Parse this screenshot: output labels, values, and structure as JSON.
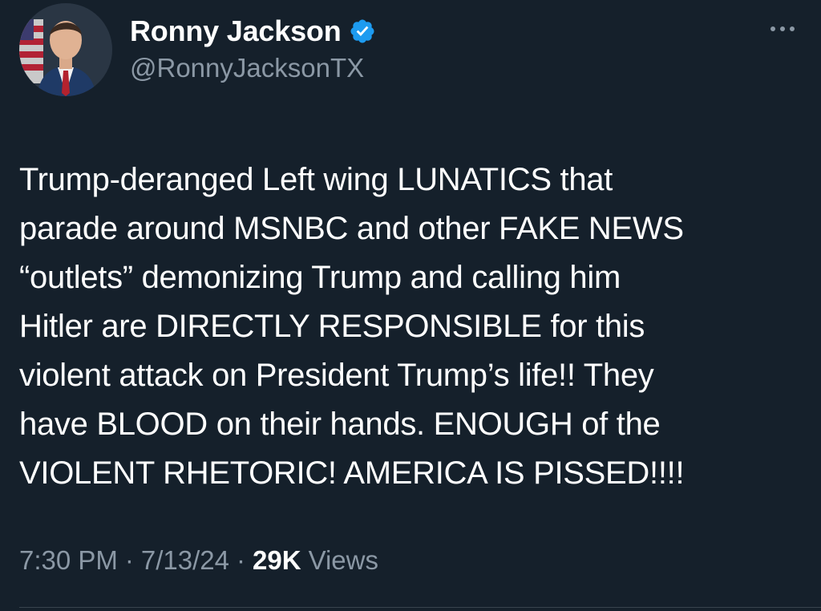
{
  "author": {
    "display_name": "Ronny Jackson",
    "handle": "@RonnyJacksonTX",
    "verified": true,
    "verified_color": "#1d9bf0"
  },
  "tweet": {
    "text": "Trump-deranged Left wing LUNATICS that\nparade around MSNBC and other FAKE NEWS\n“outlets” demonizing Trump and calling him\nHitler are DIRECTLY RESPONSIBLE for this\nviolent attack on President Trump’s life!! They\nhave BLOOD on their hands. ENOUGH of the\nVIOLENT RHETORIC! AMERICA IS PISSED!!!!",
    "time": "7:30 PM",
    "date": "7/13/24",
    "separator": "·",
    "views_count": "29K",
    "views_label": "Views"
  },
  "icons": {
    "more": "more-options-icon",
    "verified": "verified-badge-icon",
    "avatar": "profile-avatar"
  },
  "colors": {
    "background": "#15202b",
    "text": "#ffffff",
    "secondary_text": "#8b98a5"
  }
}
